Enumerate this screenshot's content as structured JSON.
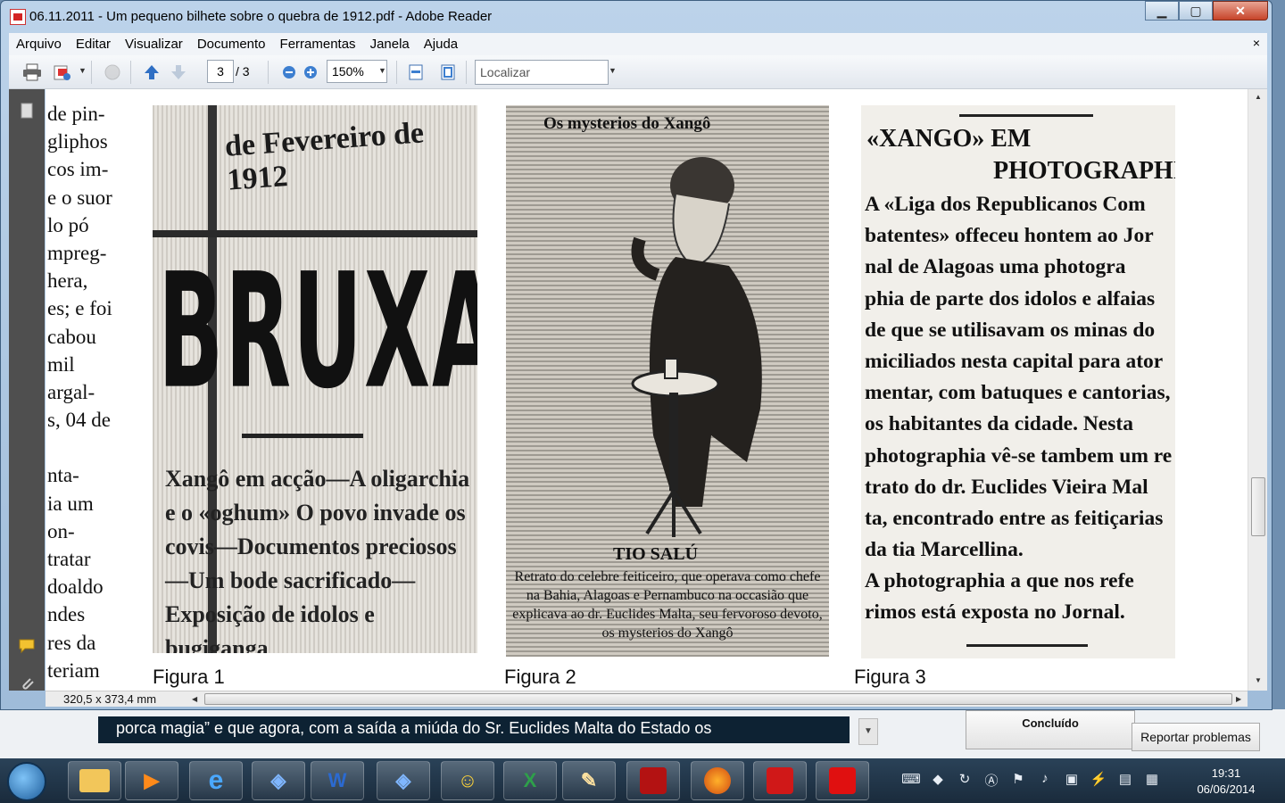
{
  "window": {
    "title": "06.11.2011 - Um pequeno bilhete sobre o quebra de 1912.pdf - Adobe Reader",
    "minimize": "▁",
    "maximize": "▢",
    "close": "✕"
  },
  "menu": [
    "Arquivo",
    "Editar",
    "Visualizar",
    "Documento",
    "Ferramentas",
    "Janela",
    "Ajuda"
  ],
  "menu_close": "×",
  "toolbar": {
    "page_current": "3",
    "page_total": "/ 3",
    "zoom": "150%",
    "search_placeholder": "Localizar",
    "icons": [
      "print-icon",
      "share-icon",
      "comment-icon",
      "prev-page-icon",
      "next-page-icon",
      "zoom-out-icon",
      "zoom-in-icon",
      "fit-width-icon",
      "fit-page-icon"
    ]
  },
  "document": {
    "left_column": [
      "de pin-",
      "gliphos",
      "cos im-",
      "e o suor",
      "lo pó",
      "mpreg-",
      "hera,",
      "es; e foi",
      "cabou",
      " mil",
      "argal-",
      "s, 04 de",
      "",
      "nta-",
      "ia um",
      "on-",
      "tratar",
      "doaldo",
      "ndes",
      "res da",
      "teriam"
    ],
    "figure1": {
      "caption": "Figura 1",
      "date": "de Fevereiro de 1912",
      "headline": "BRUXARIA",
      "subtext": "Xangô em acção—A oligarchia e o «oghum» O povo invade os covis—Documentos preciosos—Um bode sacrificado—Exposição de idolos e bugiganga"
    },
    "figure2": {
      "caption": "Figura 2",
      "header": "Os mysterios do Xangô",
      "name": "TIO SALÚ",
      "description": "Retrato do celebre feiticeiro, que operava como chefe na Bahia, Alagoas e Pernambuco na occasião que explicava ao dr. Euclides Malta, seu fervoroso devoto, os mysterios do Xangô"
    },
    "figure3": {
      "caption": "Figura 3",
      "heading1": "«XANGO» EM",
      "heading2": "PHOTOGRAPHIA",
      "lines": [
        "A «Liga dos Republicanos Com",
        "batentes» offeceu hontem ao Jor",
        "nal de Alagoas uma photogra",
        "phia de parte dos idolos e alfaias",
        "de que se utilisavam os minas do",
        "miciliados nesta capital para ator",
        "mentar, com batuques e cantorias,",
        "os habitantes da cidade. Nesta",
        "photographia vê-se tambem um re",
        "trato do dr. Euclides Vieira Mal",
        "ta, encontrado entre as feitiçarias",
        "da tia Marcellina.",
        "A photographia a que nos refe",
        "rimos está exposta no Jornal."
      ]
    },
    "page_size": "320,5 x 373,4 mm"
  },
  "background": {
    "text_line": "porca magia” e que agora, com a saída a miúda do Sr. Euclides Malta do Estado os",
    "btn_concluido": "Concluído",
    "btn_reportar": "Reportar problemas"
  },
  "taskbar": {
    "apps": [
      "folder-icon",
      "media-player-icon",
      "ie-icon",
      "virtualbox-icon",
      "word-icon",
      "virtualbox2-icon",
      "messenger-icon",
      "excel-icon",
      "paint-icon",
      "acrobat-pro-icon",
      "firefox-icon",
      "adobe-reader-icon",
      "avira-icon"
    ],
    "time": "19:31",
    "date": "06/06/2014"
  }
}
